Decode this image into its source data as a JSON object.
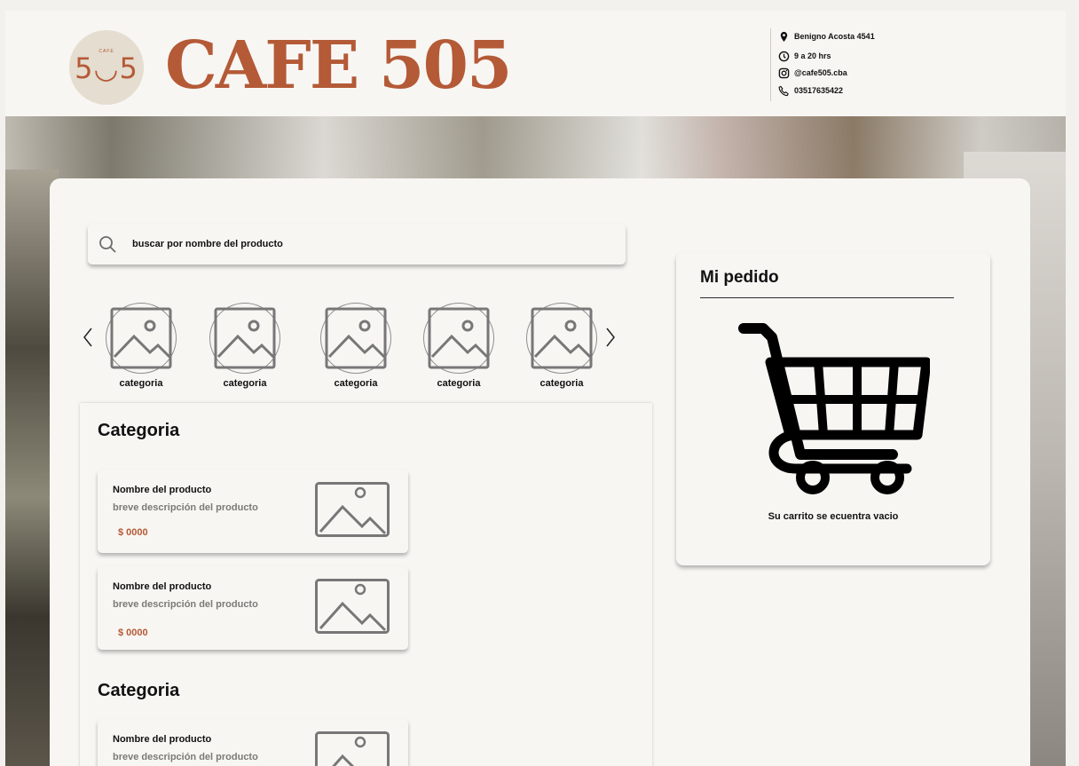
{
  "brand": {
    "logo_text": "5◡5",
    "logo_small": "CAFE",
    "name": "CAFE 505"
  },
  "contact": {
    "address": "Benigno Acosta 4541",
    "hours": "9 a 20 hrs",
    "instagram": "@cafe505.cba",
    "phone": "03517635422"
  },
  "search": {
    "placeholder": "buscar por nombre del producto"
  },
  "categories": [
    {
      "label": "categoria"
    },
    {
      "label": "categoria"
    },
    {
      "label": "categoria"
    },
    {
      "label": "categoria"
    },
    {
      "label": "categoria"
    }
  ],
  "sections": [
    {
      "title": "Categoria",
      "products": [
        {
          "name": "Nombre del producto",
          "description": "breve descripción del producto",
          "price": "$ 0000"
        },
        {
          "name": "Nombre del producto",
          "description": "breve descripción del producto",
          "price": "$ 0000"
        }
      ]
    },
    {
      "title": "Categoria",
      "products": [
        {
          "name": "Nombre del producto",
          "description": "breve descripción del producto",
          "price": ""
        }
      ]
    }
  ],
  "order": {
    "title": "Mi pedido",
    "empty_message": "Su carrito se ecuentra vacio"
  },
  "colors": {
    "brand": "#b45a36",
    "background": "#f8f6f3",
    "logo_circle": "#e4ddd0"
  },
  "icons": {
    "location": "map-pin-icon",
    "hours": "clock-icon",
    "instagram": "instagram-icon",
    "phone": "phone-icon",
    "search": "search-icon",
    "prev": "chevron-left-icon",
    "next": "chevron-right-icon",
    "category": "image-placeholder-icon",
    "cart": "shopping-cart-icon"
  }
}
